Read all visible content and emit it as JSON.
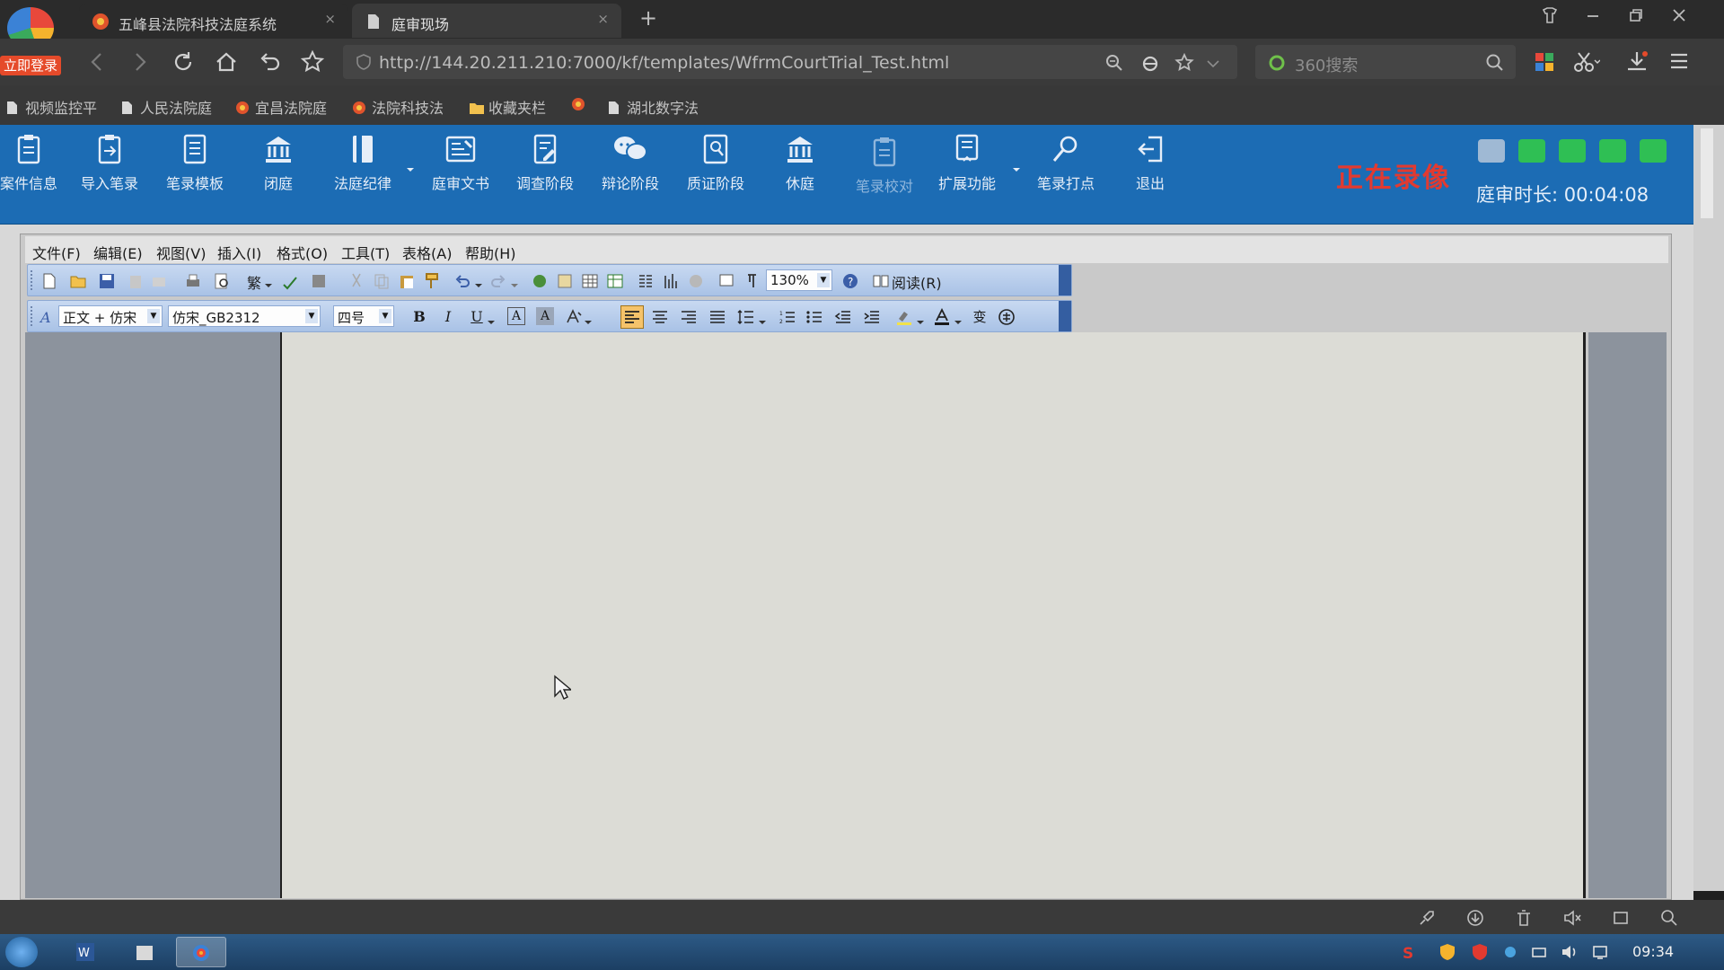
{
  "browser": {
    "login_badge": "立即登录",
    "tabs": [
      {
        "title": "五峰县法院科技法庭系统",
        "close": "×"
      },
      {
        "title": "庭审现场",
        "close": "×"
      }
    ],
    "new_tab": "+",
    "url": "http://144.20.211.210:7000/kf/templates/WfrmCourtTrial_Test.html",
    "search_placeholder": "360搜索",
    "bookmarks": [
      "视频监控平",
      "人民法院庭",
      "宜昌法院庭",
      "法院科技法",
      "收藏夹栏",
      "湖北数字法"
    ]
  },
  "app_toolbar": {
    "buttons": [
      {
        "label": "案件信息",
        "icon": "clipboard-icon"
      },
      {
        "label": "导入笔录",
        "icon": "import-icon"
      },
      {
        "label": "笔录模板",
        "icon": "template-icon"
      },
      {
        "label": "闭庭",
        "icon": "court-building-icon"
      },
      {
        "label": "法庭纪律",
        "icon": "book-icon"
      },
      {
        "label": "庭审文书",
        "icon": "document-icon"
      },
      {
        "label": "调查阶段",
        "icon": "edit-doc-icon"
      },
      {
        "label": "辩论阶段",
        "icon": "chat-icon"
      },
      {
        "label": "质证阶段",
        "icon": "evidence-icon"
      },
      {
        "label": "休庭",
        "icon": "court-building-icon"
      },
      {
        "label": "笔录校对",
        "icon": "clipboard-icon"
      },
      {
        "label": "扩展功能",
        "icon": "extend-icon"
      },
      {
        "label": "笔录打点",
        "icon": "pin-icon"
      },
      {
        "label": "退出",
        "icon": "exit-icon"
      }
    ],
    "recording_status": "正在录像",
    "duration_label": "庭审时长: 00:04:08"
  },
  "editor": {
    "menu": [
      "文件(F)",
      "编辑(E)",
      "视图(V)",
      "插入(I)",
      "格式(O)",
      "工具(T)",
      "表格(A)",
      "帮助(H)"
    ],
    "toolbar1": {
      "traditional": "繁",
      "zoom": "130%",
      "read_mode": "阅读(R)"
    },
    "toolbar2": {
      "style": "正文 + 仿宋",
      "font": "仿宋_GB2312",
      "size": "四号",
      "bold": "B",
      "italic": "I",
      "underline": "U",
      "char_a1": "A",
      "char_a2": "A",
      "pinyin": "变"
    }
  },
  "taskbar": {
    "clock": "09:34"
  },
  "colors": {
    "app_toolbar_bg": "#1c6cb4",
    "recording": "#e23a30",
    "office_toolbar": "#b9cdec"
  }
}
